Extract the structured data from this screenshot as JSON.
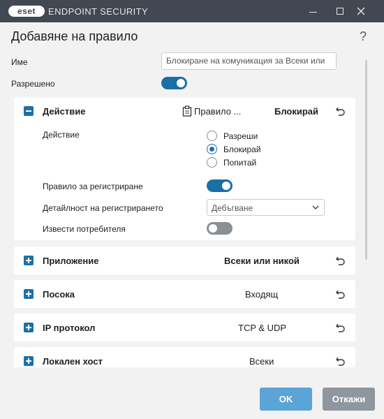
{
  "window": {
    "logo_text": "eset",
    "app_title": "ENDPOINT SECURITY",
    "minimize_icon": "minimize-icon",
    "maximize_icon": "maximize-icon",
    "close_icon": "close-icon"
  },
  "dialog": {
    "title": "Добавяне на правило",
    "help": "?"
  },
  "fields": {
    "name_label": "Име",
    "name_value": "Блокиране на комуникация за Всеки или",
    "enabled_label": "Разрешено",
    "enabled": true
  },
  "action_section": {
    "title": "Действие",
    "rule_name": "Правило ...",
    "value": "Блокирай",
    "action_label": "Действие",
    "options": [
      "Разреши",
      "Блокирай",
      "Попитай"
    ],
    "selected": "Блокирай",
    "log_rule_label": "Правило за регистриране",
    "log_rule": true,
    "log_verbosity_label": "Детайлност на регистрирането",
    "log_verbosity_value": "Дебъгване",
    "notify_user_label": "Извести потребителя",
    "notify_user": false
  },
  "sections": [
    {
      "title": "Приложение",
      "value": "Всеки или никой"
    },
    {
      "title": "Посока",
      "value": "Входящ"
    },
    {
      "title": "IP протокол",
      "value": "TCP & UDP"
    },
    {
      "title": "Локален хост",
      "value": "Всеки"
    }
  ],
  "buttons": {
    "ok": "OK",
    "cancel": "Откажи"
  },
  "colors": {
    "titlebar": "#414851",
    "accent": "#1f6fa8",
    "toggle_on": "#1a6fa6",
    "ok_button": "#5aa4d6",
    "cancel_button": "#8f969d"
  }
}
